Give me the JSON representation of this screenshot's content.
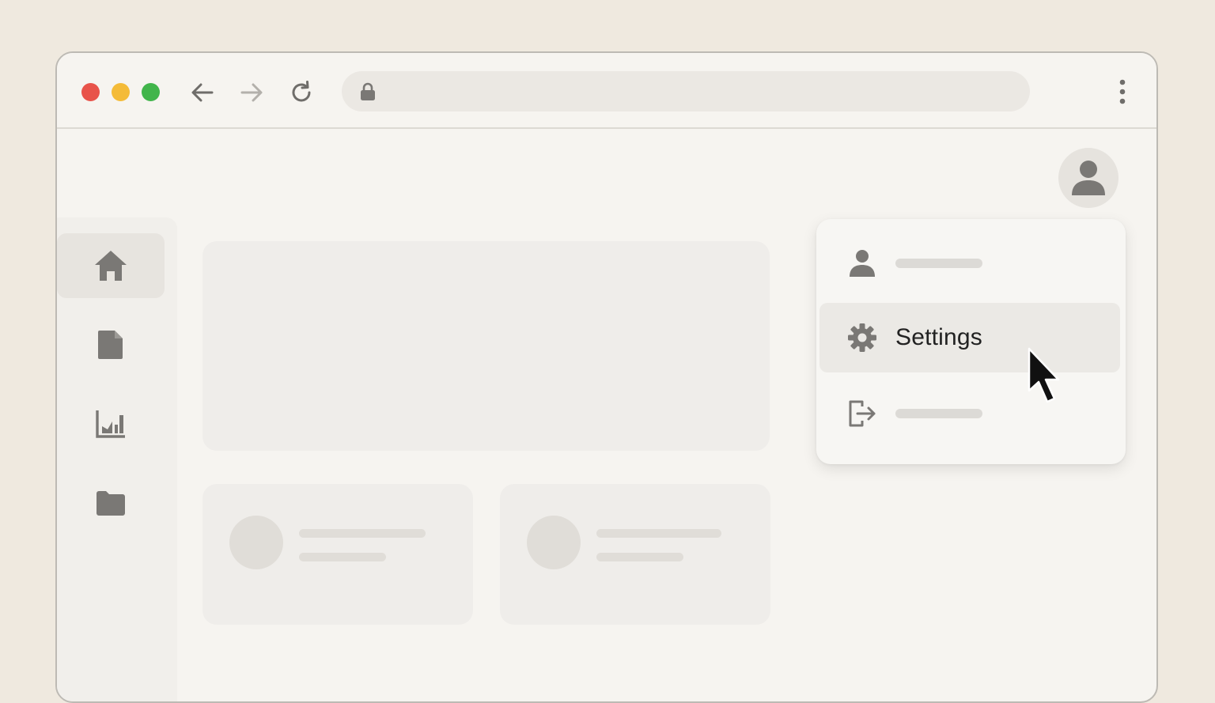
{
  "browser": {
    "traffic_lights": {
      "close": "#e8534a",
      "minimize": "#f4bb38",
      "maximize": "#41b54b"
    },
    "nav_icons": [
      "arrow-left-icon",
      "arrow-right-icon",
      "reload-icon"
    ],
    "url_icon": "lock-icon",
    "menu_icon": "more-vertical-icon"
  },
  "sidebar": {
    "items": [
      {
        "icon": "home-icon",
        "active": true
      },
      {
        "icon": "document-icon",
        "active": false
      },
      {
        "icon": "chart-icon",
        "active": false
      },
      {
        "icon": "folder-icon",
        "active": false
      }
    ]
  },
  "user_menu": {
    "trigger_icon": "user-avatar-icon",
    "items": [
      {
        "icon": "user-icon",
        "label": ""
      },
      {
        "icon": "gear-icon",
        "label": "Settings",
        "hovered": true
      },
      {
        "icon": "logout-icon",
        "label": ""
      }
    ]
  },
  "colors": {
    "background": "#efe9df",
    "window": "#f6f4f0",
    "icon": "#7a7875",
    "placeholder": "#e0ddd8"
  }
}
